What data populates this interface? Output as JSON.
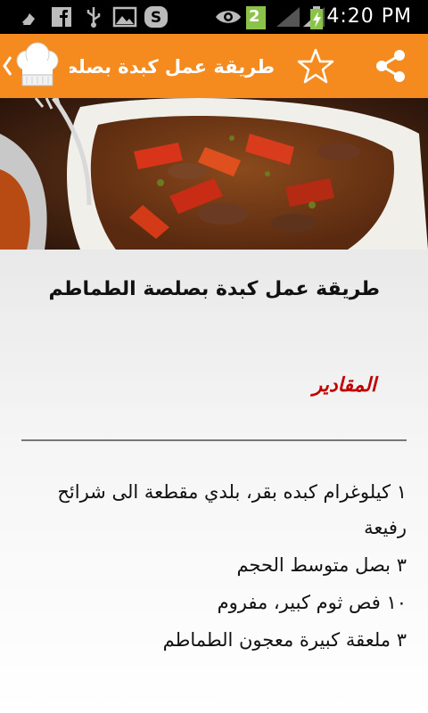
{
  "status_bar": {
    "time": "4:20 PM",
    "notification_count": "2",
    "icons": [
      "broom-icon",
      "facebook-icon",
      "usb-icon",
      "image-icon",
      "skype-icon",
      "eye-icon",
      "sim-badge-icon",
      "wifi-icon",
      "signal-icon",
      "battery-charging-icon"
    ]
  },
  "action_bar": {
    "title": "طريقة عمل كبدة بصلصة...",
    "logo": "chef-hat-icon",
    "actions": [
      "star-icon",
      "share-icon"
    ],
    "background_color": "#f58a1f"
  },
  "recipe": {
    "title": "طريقة عمل كبدة بصلصة الطماطم",
    "ingredients_heading": "المقادير",
    "heading_color": "#c00000",
    "ingredients": [
      "١ كيلوغرام كبده بقر، بلدي مقطعة الى شرائح رفيعة",
      "٣ بصل متوسط الحجم",
      "١٠ فص ثوم كبير، مفروم",
      "٣ ملعقة كبيرة معجون الطماطم"
    ]
  }
}
